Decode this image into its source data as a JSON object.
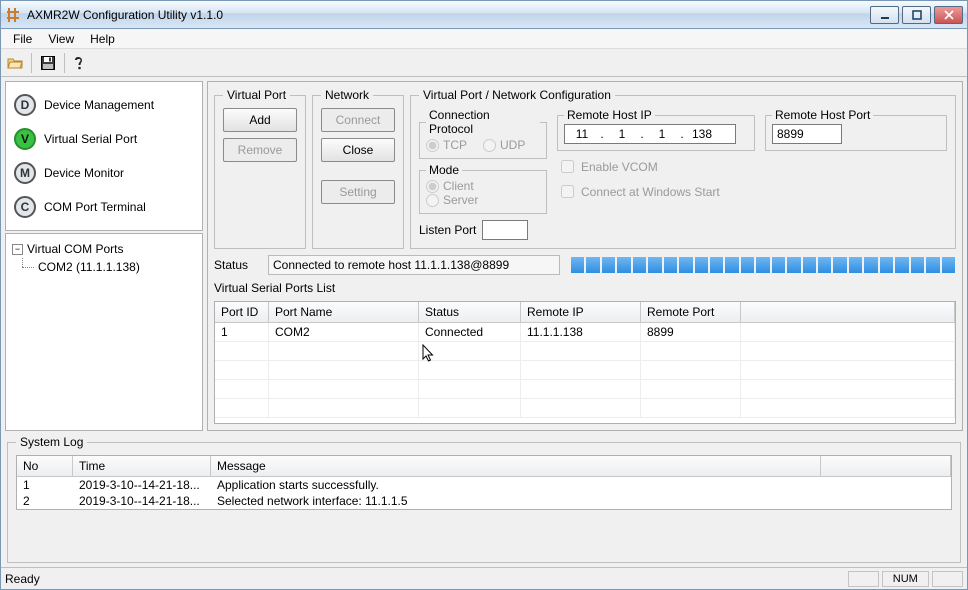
{
  "window": {
    "title": "AXMR2W Configuration Utility v1.1.0"
  },
  "menubar": {
    "file": "File",
    "view": "View",
    "help": "Help"
  },
  "nav": {
    "items": [
      {
        "letter": "D",
        "label": "Device Management"
      },
      {
        "letter": "V",
        "label": "Virtual Serial Port"
      },
      {
        "letter": "M",
        "label": "Device Monitor"
      },
      {
        "letter": "C",
        "label": "COM Port Terminal"
      }
    ]
  },
  "tree": {
    "root": "Virtual COM Ports",
    "child": "COM2 (11.1.1.138)"
  },
  "groups": {
    "virtual_port": {
      "legend": "Virtual Port",
      "add": "Add",
      "remove": "Remove"
    },
    "network": {
      "legend": "Network",
      "connect": "Connect",
      "close": "Close",
      "setting": "Setting"
    },
    "vpnc": {
      "legend": "Virtual Port / Network Configuration",
      "conn_proto": {
        "legend": "Connection Protocol",
        "tcp": "TCP",
        "udp": "UDP"
      },
      "mode": {
        "legend": "Mode",
        "client": "Client",
        "server": "Server"
      },
      "listen_port_label": "Listen Port",
      "remote_host_ip": {
        "legend": "Remote Host IP",
        "o1": "11",
        "o2": "1",
        "o3": "1",
        "o4": "138"
      },
      "enable_vcom": "Enable VCOM",
      "connect_start": "Connect at Windows Start",
      "remote_host_port": {
        "legend": "Remote Host Port",
        "value": "8899"
      }
    }
  },
  "status": {
    "label": "Status",
    "text": "Connected to remote host 11.1.1.138@8899"
  },
  "vsp_list": {
    "label": "Virtual Serial Ports List",
    "headers": {
      "port_id": "Port ID",
      "port_name": "Port Name",
      "status": "Status",
      "remote_ip": "Remote IP",
      "remote_port": "Remote Port"
    },
    "rows": [
      {
        "port_id": "1",
        "port_name": "COM2",
        "status": "Connected",
        "remote_ip": "11.1.1.138",
        "remote_port": "8899"
      }
    ]
  },
  "syslog": {
    "legend": "System Log",
    "headers": {
      "no": "No",
      "time": "Time",
      "message": "Message"
    },
    "rows": [
      {
        "no": "1",
        "time": "2019-3-10--14-21-18...",
        "message": "Application starts successfully."
      },
      {
        "no": "2",
        "time": "2019-3-10--14-21-18...",
        "message": "Selected network interface: 11.1.1.5"
      }
    ]
  },
  "statusbar": {
    "ready": "Ready",
    "num": "NUM"
  }
}
